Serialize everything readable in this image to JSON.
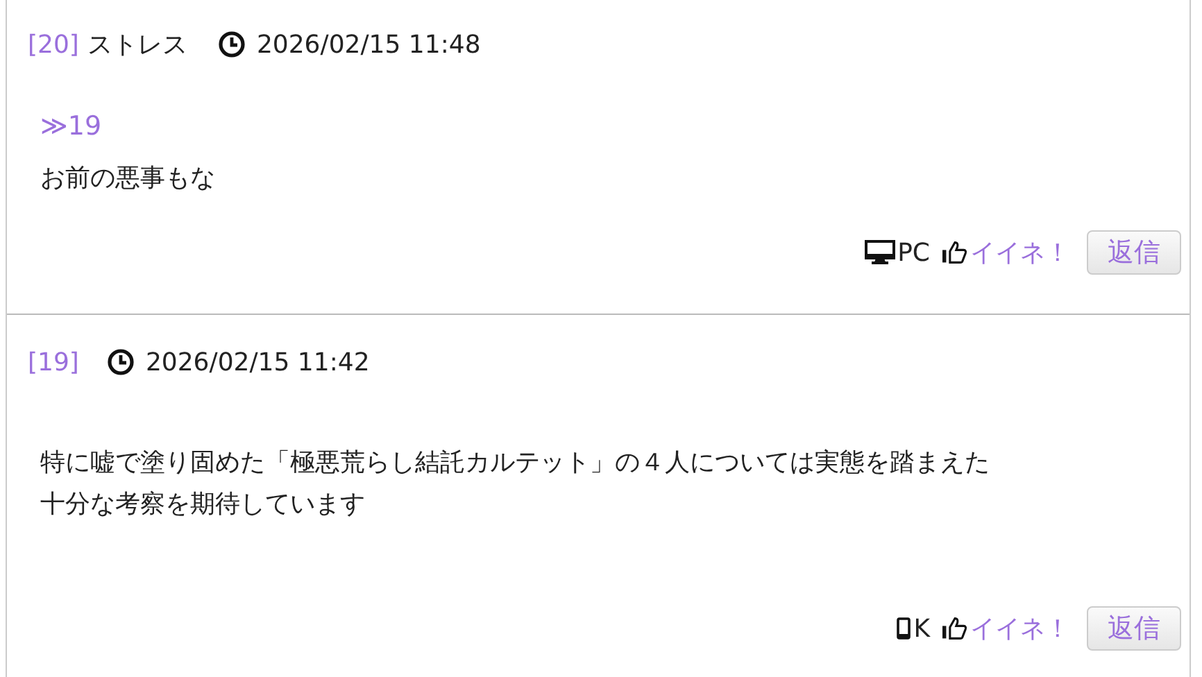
{
  "posts": [
    {
      "number": "[20]",
      "name": "ストレス",
      "time": "2026/02/15 11:48",
      "anchor": "≫19",
      "body_lines": [
        "お前の悪事もな"
      ],
      "device": {
        "kind": "pc",
        "label": "PC"
      },
      "like": "イイネ！",
      "reply": "返信"
    },
    {
      "number": "[19]",
      "time": "2026/02/15 11:42",
      "body_lines": [
        "特に嘘で塗り固めた「極悪荒らし結託カルテット」の４人については実態を踏まえた",
        "十分な考察を期待しています"
      ],
      "device": {
        "kind": "mobile",
        "label": "K"
      },
      "like": "イイネ！",
      "reply": "返信"
    }
  ]
}
